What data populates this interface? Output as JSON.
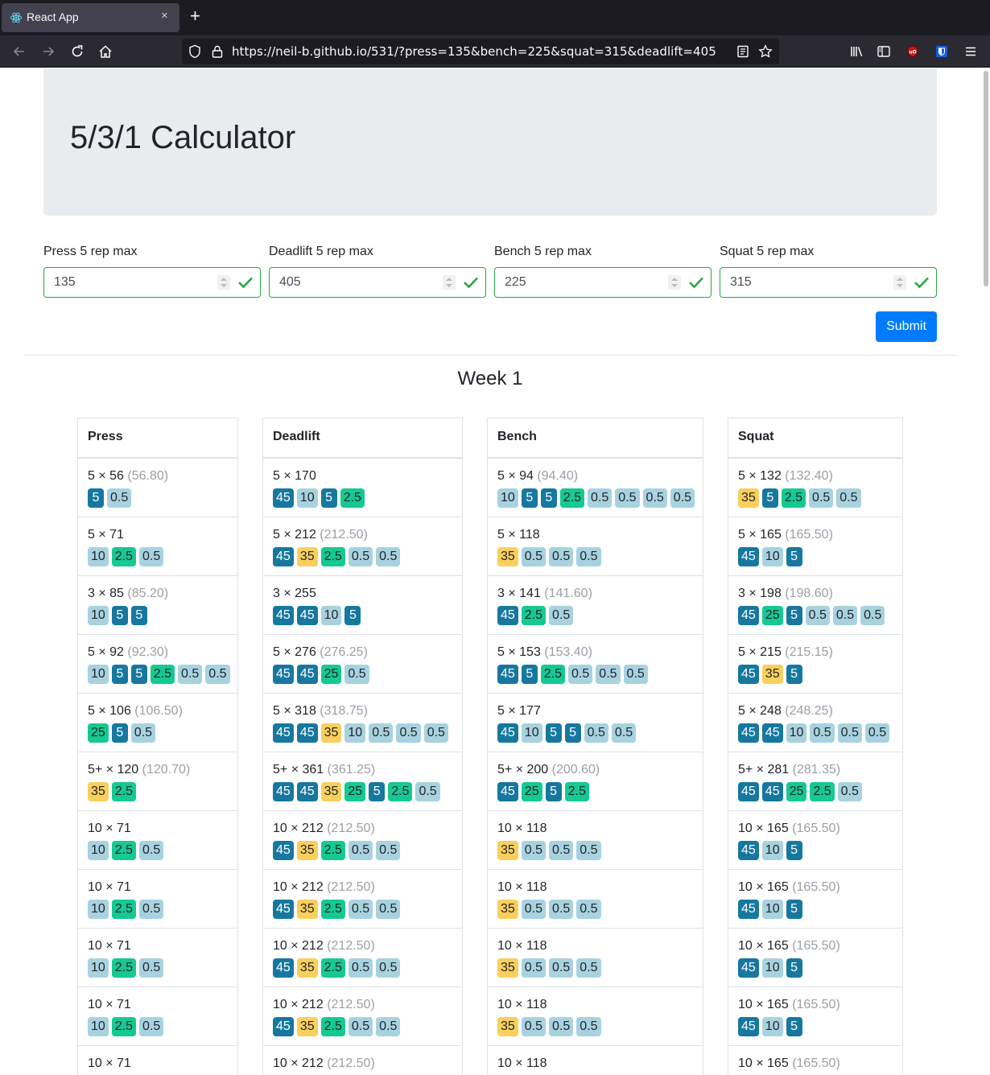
{
  "browser": {
    "tab_title": "React App",
    "tab_close": "×",
    "new_tab": "+",
    "url": "https://neil-b.github.io/531/?press=135&bench=225&squat=315&deadlift=405"
  },
  "page": {
    "title": "5/3/1 Calculator",
    "submit_label": "Submit",
    "week_title": "Week 1",
    "inputs": [
      {
        "label": "Press 5 rep max",
        "value": "135"
      },
      {
        "label": "Deadlift 5 rep max",
        "value": "405"
      },
      {
        "label": "Bench 5 rep max",
        "value": "225"
      },
      {
        "label": "Squat 5 rep max",
        "value": "315"
      }
    ]
  },
  "colors": {
    "plate_45": "#17789f",
    "plate_35": "#f9cf5d",
    "plate_25": "#15c993",
    "plate_10": "#a8d2e0",
    "plate_5": "#17789f",
    "plate_2_5": "#15c993",
    "plate_0_5": "#a8d2e0",
    "valid_border": "#28a745",
    "submit_bg": "#007bff"
  },
  "lifts": [
    {
      "name": "Press",
      "sets": [
        {
          "reps": "5",
          "weight": "56",
          "exact": "(56.80)",
          "plates": [
            "5",
            "0.5"
          ]
        },
        {
          "reps": "5",
          "weight": "71",
          "exact": "",
          "plates": [
            "10",
            "2.5",
            "0.5"
          ]
        },
        {
          "reps": "3",
          "weight": "85",
          "exact": "(85.20)",
          "plates": [
            "10",
            "5",
            "5"
          ]
        },
        {
          "reps": "5",
          "weight": "92",
          "exact": "(92.30)",
          "plates": [
            "10",
            "5",
            "5",
            "2.5",
            "0.5",
            "0.5"
          ]
        },
        {
          "reps": "5",
          "weight": "106",
          "exact": "(106.50)",
          "plates": [
            "25",
            "5",
            "0.5"
          ]
        },
        {
          "reps": "5+",
          "weight": "120",
          "exact": "(120.70)",
          "plates": [
            "35",
            "2.5"
          ]
        },
        {
          "reps": "10",
          "weight": "71",
          "exact": "",
          "plates": [
            "10",
            "2.5",
            "0.5"
          ]
        },
        {
          "reps": "10",
          "weight": "71",
          "exact": "",
          "plates": [
            "10",
            "2.5",
            "0.5"
          ]
        },
        {
          "reps": "10",
          "weight": "71",
          "exact": "",
          "plates": [
            "10",
            "2.5",
            "0.5"
          ]
        },
        {
          "reps": "10",
          "weight": "71",
          "exact": "",
          "plates": [
            "10",
            "2.5",
            "0.5"
          ]
        },
        {
          "reps": "10",
          "weight": "71",
          "exact": "",
          "plates": []
        }
      ]
    },
    {
      "name": "Deadlift",
      "sets": [
        {
          "reps": "5",
          "weight": "170",
          "exact": "",
          "plates": [
            "45",
            "10",
            "5",
            "2.5"
          ]
        },
        {
          "reps": "5",
          "weight": "212",
          "exact": "(212.50)",
          "plates": [
            "45",
            "35",
            "2.5",
            "0.5",
            "0.5"
          ]
        },
        {
          "reps": "3",
          "weight": "255",
          "exact": "",
          "plates": [
            "45",
            "45",
            "10",
            "5"
          ]
        },
        {
          "reps": "5",
          "weight": "276",
          "exact": "(276.25)",
          "plates": [
            "45",
            "45",
            "25",
            "0.5"
          ]
        },
        {
          "reps": "5",
          "weight": "318",
          "exact": "(318.75)",
          "plates": [
            "45",
            "45",
            "35",
            "10",
            "0.5",
            "0.5",
            "0.5"
          ]
        },
        {
          "reps": "5+",
          "weight": "361",
          "exact": "(361.25)",
          "plates": [
            "45",
            "45",
            "35",
            "25",
            "5",
            "2.5",
            "0.5"
          ]
        },
        {
          "reps": "10",
          "weight": "212",
          "exact": "(212.50)",
          "plates": [
            "45",
            "35",
            "2.5",
            "0.5",
            "0.5"
          ]
        },
        {
          "reps": "10",
          "weight": "212",
          "exact": "(212.50)",
          "plates": [
            "45",
            "35",
            "2.5",
            "0.5",
            "0.5"
          ]
        },
        {
          "reps": "10",
          "weight": "212",
          "exact": "(212.50)",
          "plates": [
            "45",
            "35",
            "2.5",
            "0.5",
            "0.5"
          ]
        },
        {
          "reps": "10",
          "weight": "212",
          "exact": "(212.50)",
          "plates": [
            "45",
            "35",
            "2.5",
            "0.5",
            "0.5"
          ]
        },
        {
          "reps": "10",
          "weight": "212",
          "exact": "(212.50)",
          "plates": []
        }
      ]
    },
    {
      "name": "Bench",
      "sets": [
        {
          "reps": "5",
          "weight": "94",
          "exact": "(94.40)",
          "plates": [
            "10",
            "5",
            "5",
            "2.5",
            "0.5",
            "0.5",
            "0.5",
            "0.5"
          ]
        },
        {
          "reps": "5",
          "weight": "118",
          "exact": "",
          "plates": [
            "35",
            "0.5",
            "0.5",
            "0.5"
          ]
        },
        {
          "reps": "3",
          "weight": "141",
          "exact": "(141.60)",
          "plates": [
            "45",
            "2.5",
            "0.5"
          ]
        },
        {
          "reps": "5",
          "weight": "153",
          "exact": "(153.40)",
          "plates": [
            "45",
            "5",
            "2.5",
            "0.5",
            "0.5",
            "0.5"
          ]
        },
        {
          "reps": "5",
          "weight": "177",
          "exact": "",
          "plates": [
            "45",
            "10",
            "5",
            "5",
            "0.5",
            "0.5"
          ]
        },
        {
          "reps": "5+",
          "weight": "200",
          "exact": "(200.60)",
          "plates": [
            "45",
            "25",
            "5",
            "2.5"
          ]
        },
        {
          "reps": "10",
          "weight": "118",
          "exact": "",
          "plates": [
            "35",
            "0.5",
            "0.5",
            "0.5"
          ]
        },
        {
          "reps": "10",
          "weight": "118",
          "exact": "",
          "plates": [
            "35",
            "0.5",
            "0.5",
            "0.5"
          ]
        },
        {
          "reps": "10",
          "weight": "118",
          "exact": "",
          "plates": [
            "35",
            "0.5",
            "0.5",
            "0.5"
          ]
        },
        {
          "reps": "10",
          "weight": "118",
          "exact": "",
          "plates": [
            "35",
            "0.5",
            "0.5",
            "0.5"
          ]
        },
        {
          "reps": "10",
          "weight": "118",
          "exact": "",
          "plates": []
        }
      ]
    },
    {
      "name": "Squat",
      "sets": [
        {
          "reps": "5",
          "weight": "132",
          "exact": "(132.40)",
          "plates": [
            "35",
            "5",
            "2.5",
            "0.5",
            "0.5"
          ]
        },
        {
          "reps": "5",
          "weight": "165",
          "exact": "(165.50)",
          "plates": [
            "45",
            "10",
            "5"
          ]
        },
        {
          "reps": "3",
          "weight": "198",
          "exact": "(198.60)",
          "plates": [
            "45",
            "25",
            "5",
            "0.5",
            "0.5",
            "0.5"
          ]
        },
        {
          "reps": "5",
          "weight": "215",
          "exact": "(215.15)",
          "plates": [
            "45",
            "35",
            "5"
          ]
        },
        {
          "reps": "5",
          "weight": "248",
          "exact": "(248.25)",
          "plates": [
            "45",
            "45",
            "10",
            "0.5",
            "0.5",
            "0.5"
          ]
        },
        {
          "reps": "5+",
          "weight": "281",
          "exact": "(281.35)",
          "plates": [
            "45",
            "45",
            "25",
            "2.5",
            "0.5"
          ]
        },
        {
          "reps": "10",
          "weight": "165",
          "exact": "(165.50)",
          "plates": [
            "45",
            "10",
            "5"
          ]
        },
        {
          "reps": "10",
          "weight": "165",
          "exact": "(165.50)",
          "plates": [
            "45",
            "10",
            "5"
          ]
        },
        {
          "reps": "10",
          "weight": "165",
          "exact": "(165.50)",
          "plates": [
            "45",
            "10",
            "5"
          ]
        },
        {
          "reps": "10",
          "weight": "165",
          "exact": "(165.50)",
          "plates": [
            "45",
            "10",
            "5"
          ]
        },
        {
          "reps": "10",
          "weight": "165",
          "exact": "(165.50)",
          "plates": []
        }
      ]
    }
  ]
}
